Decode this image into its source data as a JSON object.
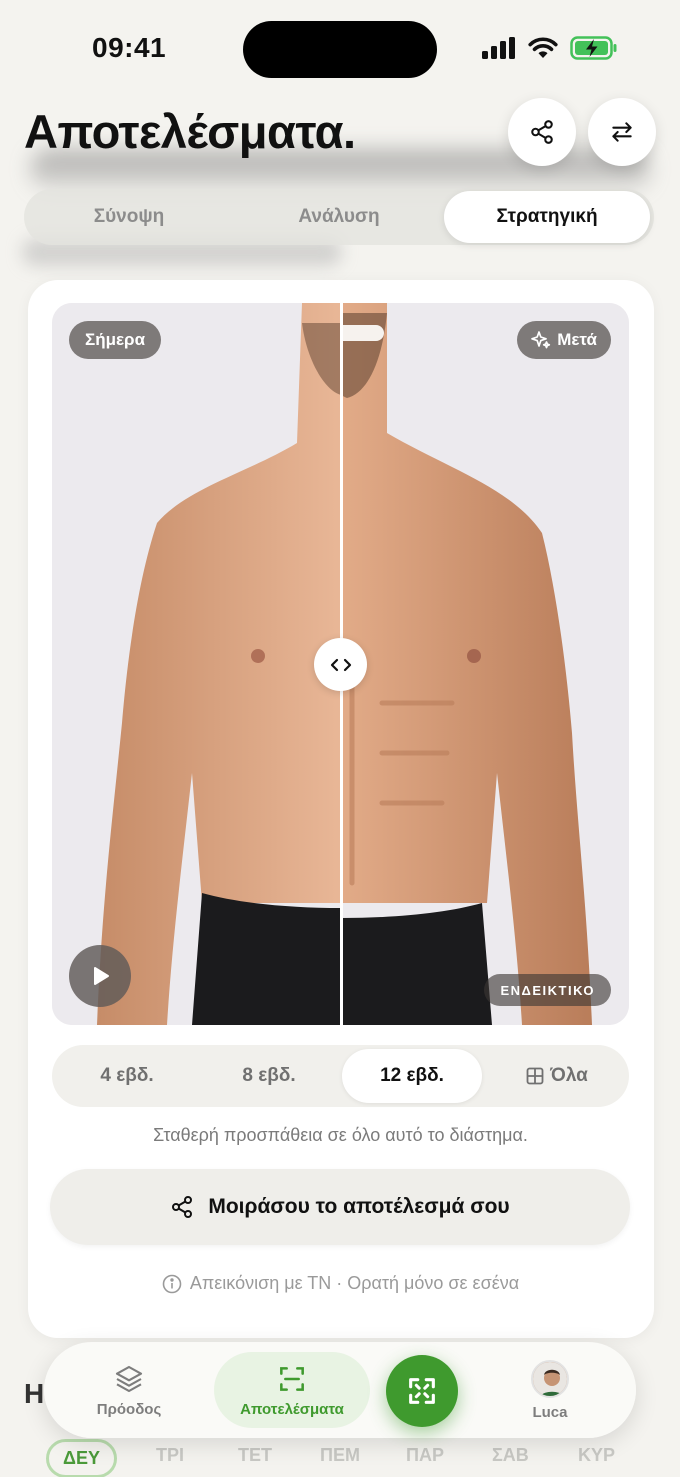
{
  "status_bar": {
    "time": "09:41"
  },
  "header": {
    "title": "Αποτελέσματα."
  },
  "tabs": [
    {
      "label": "Σύνοψη"
    },
    {
      "label": "Ανάλυση"
    },
    {
      "label": "Στρατηγική",
      "active": true
    }
  ],
  "comparison": {
    "before_label": "Σήμερα",
    "after_label": "Μετά",
    "badge": "ΕΝΔΕΙΚΤΙΚΟ",
    "slider_position": 0.5
  },
  "durations": [
    {
      "label": "4 εβδ."
    },
    {
      "label": "8 εβδ."
    },
    {
      "label": "12 εβδ.",
      "active": true
    },
    {
      "label": "Όλα",
      "icon": "grid-icon"
    }
  ],
  "caption": "Σταθερή προσπάθεια σε όλο αυτό το διάστημα.",
  "share_button": {
    "label": "Μοιράσου το αποτέλεσμά σου"
  },
  "disclaimer": "Απεικόνιση με ΤΝ · Ορατή μόνο σε εσένα",
  "background": {
    "heading_initial": "Η",
    "days": [
      "ΔΕΥ",
      "ΤΡΙ",
      "ΤΕΤ",
      "ΠΕΜ",
      "ΠΑΡ",
      "ΣΑΒ",
      "ΚΥΡ"
    ]
  },
  "nav": {
    "items": [
      {
        "label": "Πρόοδος",
        "icon": "layers-icon"
      },
      {
        "label": "Αποτελέσματα",
        "icon": "scan-icon",
        "active": true
      },
      {
        "label": "Luca",
        "icon": "avatar"
      }
    ]
  },
  "colors": {
    "accent": "#3f9a2e",
    "background": "#f4f3ef"
  }
}
